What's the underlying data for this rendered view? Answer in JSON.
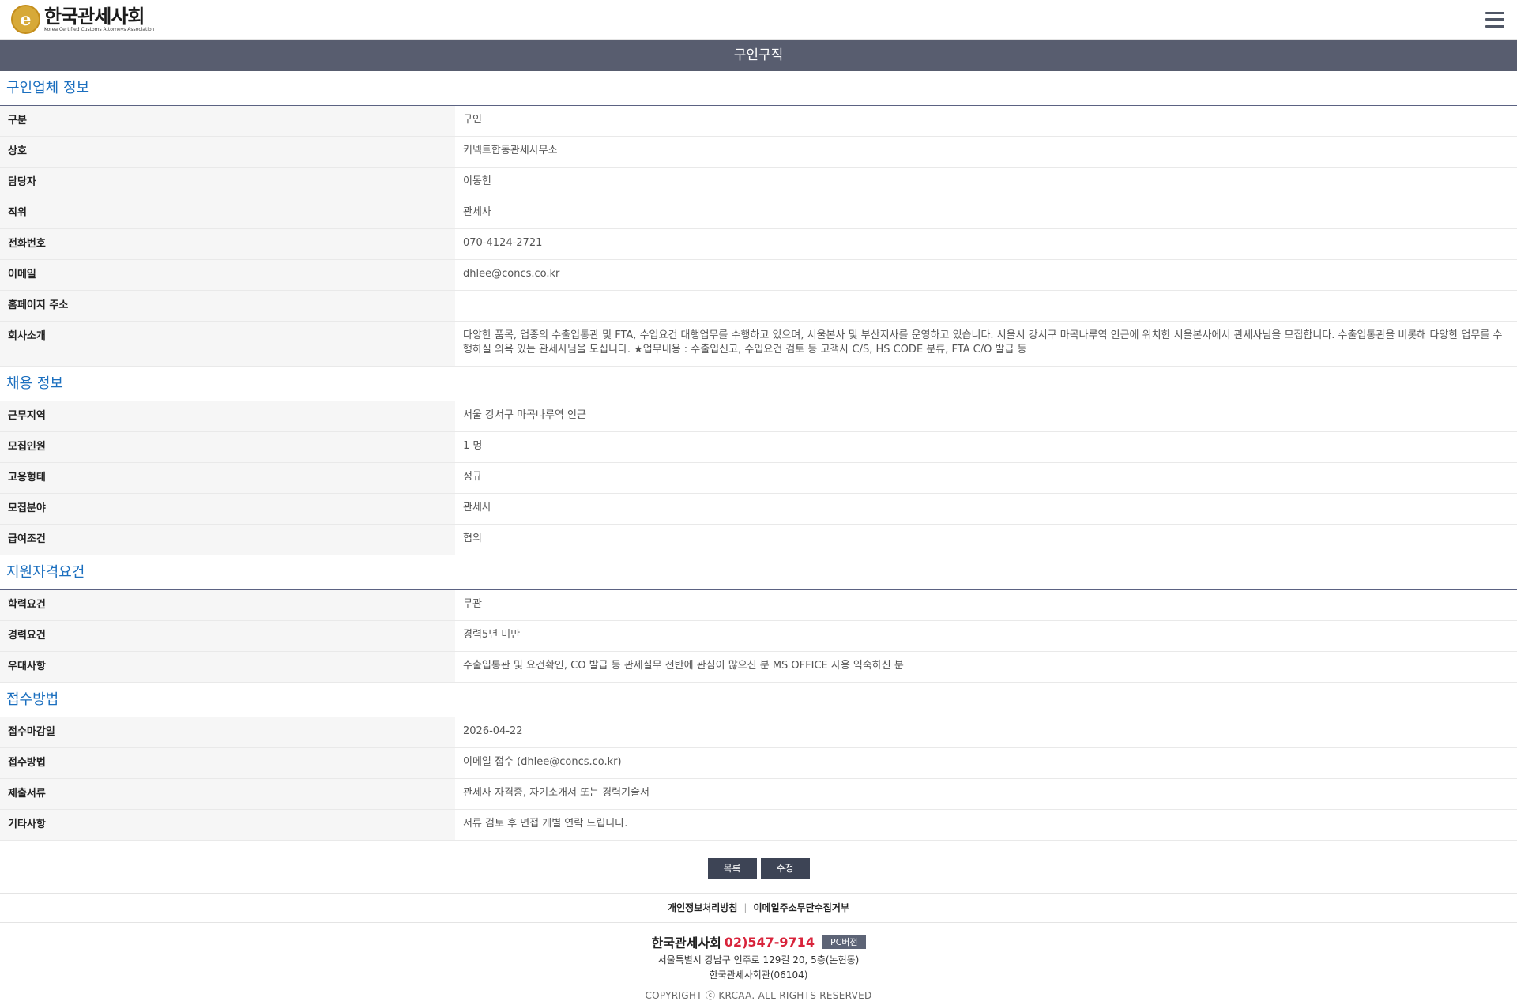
{
  "header": {
    "logo_kr": "한국관세사회",
    "logo_en": "Korea Certified Customs Attorneys Association"
  },
  "page_title": "구인구직",
  "sections": [
    {
      "title": "구인업체 정보",
      "rows": [
        {
          "label": "구분",
          "value": "구인"
        },
        {
          "label": "상호",
          "value": "커넥트합동관세사무소"
        },
        {
          "label": "담당자",
          "value": "이동헌"
        },
        {
          "label": "직위",
          "value": "관세사"
        },
        {
          "label": "전화번호",
          "value": "070-4124-2721"
        },
        {
          "label": "이메일",
          "value": "dhlee@concs.co.kr"
        },
        {
          "label": "홈페이지 주소",
          "value": ""
        },
        {
          "label": "회사소개",
          "value": "다양한 품목, 업종의 수출입통관 및 FTA, 수입요건 대행업무를 수행하고 있으며, 서울본사 및 부산지사를 운영하고 있습니다. 서울시 강서구 마곡나루역 인근에 위치한 서울본사에서 관세사님을 모집합니다. 수출입통관을 비롯해 다양한 업무를 수행하실 의욕 있는 관세사님을 모십니다. ★업무내용 : 수출입신고, 수입요건 검토 등 고객사 C/S, HS CODE 분류, FTA C/O 발급 등"
        }
      ]
    },
    {
      "title": "채용 정보",
      "rows": [
        {
          "label": "근무지역",
          "value": "서울 강서구 마곡나루역 인근"
        },
        {
          "label": "모집인원",
          "value": "1 명"
        },
        {
          "label": "고용형태",
          "value": "정규"
        },
        {
          "label": "모집분야",
          "value": "관세사"
        },
        {
          "label": "급여조건",
          "value": "협의"
        }
      ]
    },
    {
      "title": "지원자격요건",
      "rows": [
        {
          "label": "학력요건",
          "value": "무관"
        },
        {
          "label": "경력요건",
          "value": "경력5년 미만"
        },
        {
          "label": "우대사항",
          "value": "수출입통관 및 요건확인, CO 발급 등 관세실무 전반에 관심이 많으신 분 MS OFFICE 사용 익숙하신 분"
        }
      ]
    },
    {
      "title": "접수방법",
      "rows": [
        {
          "label": "접수마감일",
          "value": "2026-04-22"
        },
        {
          "label": "접수방법",
          "value": "이메일 접수 (dhlee@concs.co.kr)"
        },
        {
          "label": "제출서류",
          "value": "관세사 자격증, 자기소개서 또는 경력기술서"
        },
        {
          "label": "기타사항",
          "value": "서류 검토 후 면접 개별 연락 드립니다."
        }
      ]
    }
  ],
  "buttons": {
    "list": "목록",
    "edit": "수정"
  },
  "footer": {
    "link_privacy": "개인정보처리방침",
    "link_email": "이메일주소무단수집거부",
    "org_name": "한국관세사회",
    "phone": "02)547-9714",
    "pc_version": "PC버전",
    "address1": "서울특별시 강남구 언주로 129길 20, 5층(논현동)",
    "address2": "한국관세사회관(06104)",
    "copyright": "COPYRIGHT ⓒ KRCAA. ALL RIGHTS RESERVED"
  },
  "icons": {
    "menu": "hamburger-menu-icon",
    "logo": "krcaa-logo-icon"
  },
  "colors": {
    "title_bar": "#585d6f",
    "section_title": "#1b6fbf",
    "button": "#3d4455",
    "phone": "#d8243b"
  }
}
